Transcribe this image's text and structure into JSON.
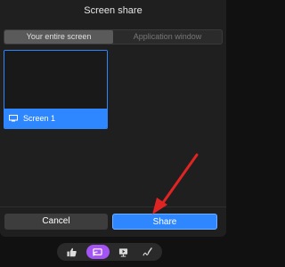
{
  "dialog": {
    "title": "Screen share"
  },
  "tabs": [
    {
      "label": "Your entire screen",
      "active": true
    },
    {
      "label": "Application window",
      "active": false
    }
  ],
  "screens": [
    {
      "label": "Screen 1",
      "icon": "monitor-icon",
      "selected": true
    }
  ],
  "buttons": {
    "cancel_label": "Cancel",
    "share_label": "Share"
  },
  "toolbar": {
    "items": [
      {
        "icon": "thumbs-up-icon",
        "active": false
      },
      {
        "icon": "screen-share-icon",
        "active": true
      },
      {
        "icon": "present-icon",
        "active": false
      },
      {
        "icon": "draw-icon",
        "active": false
      }
    ]
  },
  "colors": {
    "accent": "#2f87ff",
    "share_active": "#a453f4",
    "annotation_arrow": "#e02424"
  }
}
